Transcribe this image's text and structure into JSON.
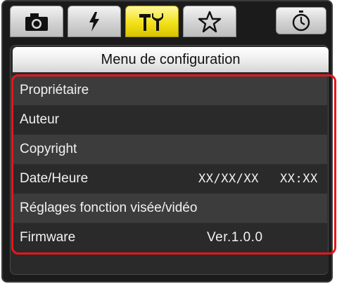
{
  "tabs": [
    {
      "id": "camera",
      "icon": "camera-icon",
      "active": false
    },
    {
      "id": "flash",
      "icon": "flash-icon",
      "active": false
    },
    {
      "id": "setup",
      "icon": "wrench-icon",
      "active": true
    },
    {
      "id": "mymenu",
      "icon": "star-icon",
      "active": false
    },
    {
      "id": "timer",
      "icon": "stopwatch-icon",
      "active": false
    }
  ],
  "menu": {
    "title": "Menu de configuration",
    "items": [
      {
        "label": "Propriétaire",
        "value": ""
      },
      {
        "label": "Auteur",
        "value": ""
      },
      {
        "label": "Copyright",
        "value": ""
      },
      {
        "label": "Date/Heure",
        "date": "XX/XX/XX",
        "time": "XX:XX"
      },
      {
        "label": "Réglages fonction visée/vidéo",
        "value": ""
      },
      {
        "label": "Firmware",
        "value": "Ver.1.0.0"
      }
    ]
  },
  "colors": {
    "active_tab": "#f2e11a",
    "highlight_border": "#e8151c",
    "panel_bg": "#2a2a2a",
    "row_alt_bg": "#3c3c3c"
  }
}
